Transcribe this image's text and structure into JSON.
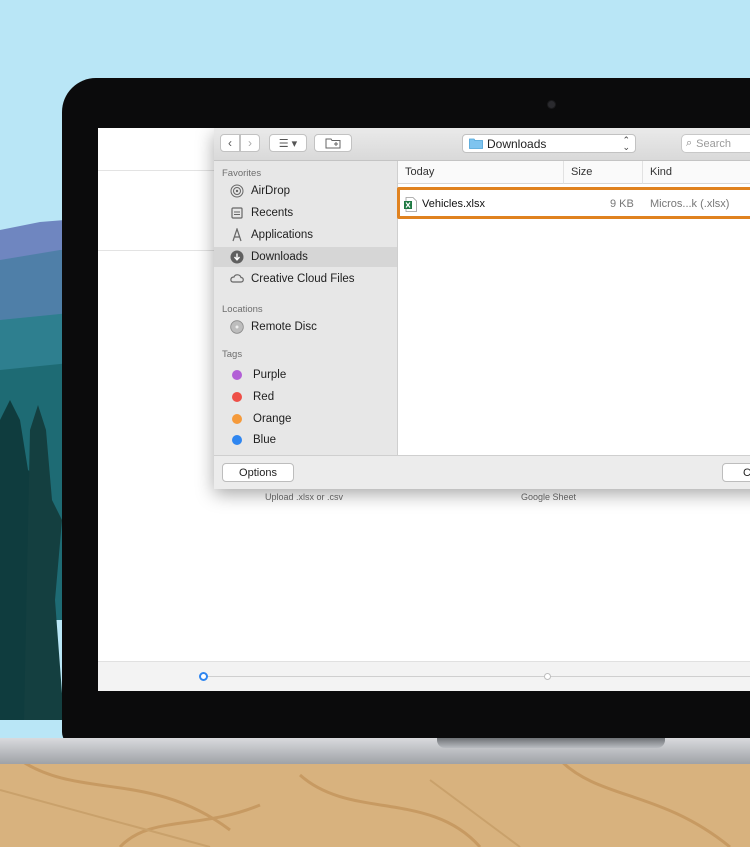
{
  "toolbar": {
    "location": "Downloads",
    "search_placeholder": "Search"
  },
  "sidebar": {
    "favorites_header": "Favorites",
    "favorites": [
      {
        "label": "AirDrop",
        "icon": "airdrop-icon"
      },
      {
        "label": "Recents",
        "icon": "recents-icon"
      },
      {
        "label": "Applications",
        "icon": "applications-icon"
      },
      {
        "label": "Downloads",
        "icon": "downloads-icon",
        "selected": true
      },
      {
        "label": "Creative Cloud Files",
        "icon": "creative-cloud-icon"
      }
    ],
    "locations_header": "Locations",
    "locations": [
      {
        "label": "Remote Disc",
        "icon": "disc-icon"
      }
    ],
    "tags_header": "Tags",
    "tags": [
      {
        "label": "Purple",
        "color": "#b25fd6"
      },
      {
        "label": "Red",
        "color": "#ee4f47"
      },
      {
        "label": "Orange",
        "color": "#f59a3b"
      },
      {
        "label": "Blue",
        "color": "#2f86f0"
      }
    ]
  },
  "columns": {
    "name": "Today",
    "size": "Size",
    "kind": "Kind"
  },
  "files": [
    {
      "name": "Vehicles.xlsx",
      "size": "9 KB",
      "kind": "Micros...k (.xlsx)",
      "icon": "excel-file-icon",
      "highlighted": true
    }
  ],
  "footer": {
    "options_label": "Options",
    "cancel_label": "C"
  },
  "app_background": {
    "upload_caption": "Upload .xlsx or .csv",
    "google_caption": "Google Sheet"
  },
  "colors": {
    "highlight": "#e0821f",
    "sky": "#b9e6f6",
    "step_active": "#2f86f0"
  }
}
